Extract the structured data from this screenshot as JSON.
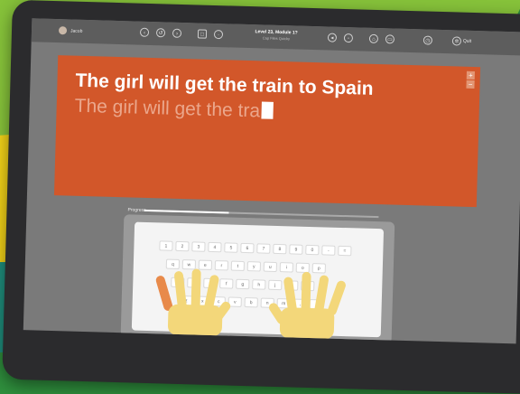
{
  "topbar": {
    "user_name": "Jacob",
    "lesson_title": "Level 23, Module 1?",
    "lesson_subtitle": "Cap Files Quicky",
    "quit_label": "Quit"
  },
  "exercise": {
    "target_text": "The girl will get the train to Spain",
    "typed_text": "The girl will get the tra",
    "zoom_in": "+",
    "zoom_out": "−"
  },
  "progress": {
    "label": "Progress",
    "value": 0.36
  },
  "keyboard": {
    "number_row": [
      "1",
      "2",
      "3",
      "4",
      "5",
      "6",
      "7",
      "8",
      "9",
      "0",
      "-",
      "="
    ],
    "top_row": [
      "q",
      "w",
      "e",
      "r",
      "t",
      "y",
      "u",
      "i",
      "o",
      "p"
    ],
    "home_row": [
      "a",
      "s",
      "d",
      "f",
      "g",
      "h",
      "j",
      "k",
      "l"
    ],
    "bottom_row": [
      "z",
      "x",
      "c",
      "v",
      "b",
      "n",
      "m",
      ",",
      "."
    ]
  },
  "colors": {
    "panel": "#d2572a",
    "typed_text": "#eba78c",
    "active_finger": "#e88a4a"
  }
}
